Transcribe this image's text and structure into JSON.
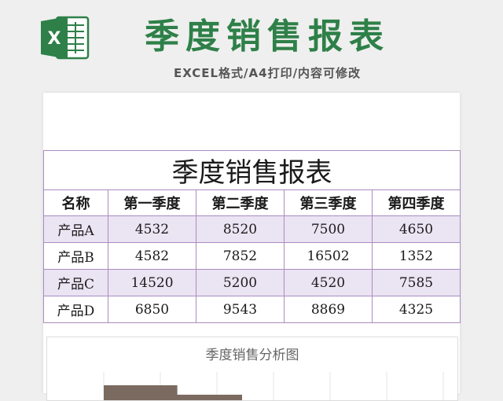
{
  "header": {
    "title": "季度销售报表",
    "subtitle": "EXCEL格式/A4打印/内容可修改",
    "logo_letter": "X"
  },
  "sheet": {
    "title": "季度销售报表",
    "columns": [
      "名称",
      "第一季度",
      "第二季度",
      "第三季度",
      "第四季度"
    ],
    "rows": [
      {
        "name": "产品A",
        "values": [
          "4532",
          "8520",
          "7500",
          "4650"
        ]
      },
      {
        "name": "产品B",
        "values": [
          "4582",
          "7852",
          "16502",
          "1352"
        ]
      },
      {
        "name": "产品C",
        "values": [
          "14520",
          "5200",
          "4520",
          "7585"
        ]
      },
      {
        "name": "产品D",
        "values": [
          "6850",
          "9543",
          "8869",
          "4325"
        ]
      }
    ]
  },
  "chart": {
    "title": "季度销售分析图",
    "visible_bars": [
      {
        "value": 4532
      },
      {
        "value": 8520
      }
    ]
  },
  "colors": {
    "brand_green": "#2e8048",
    "row_shade": "#ebe4f3",
    "border": "#a98cc0",
    "bar": "#7b6a60"
  }
}
